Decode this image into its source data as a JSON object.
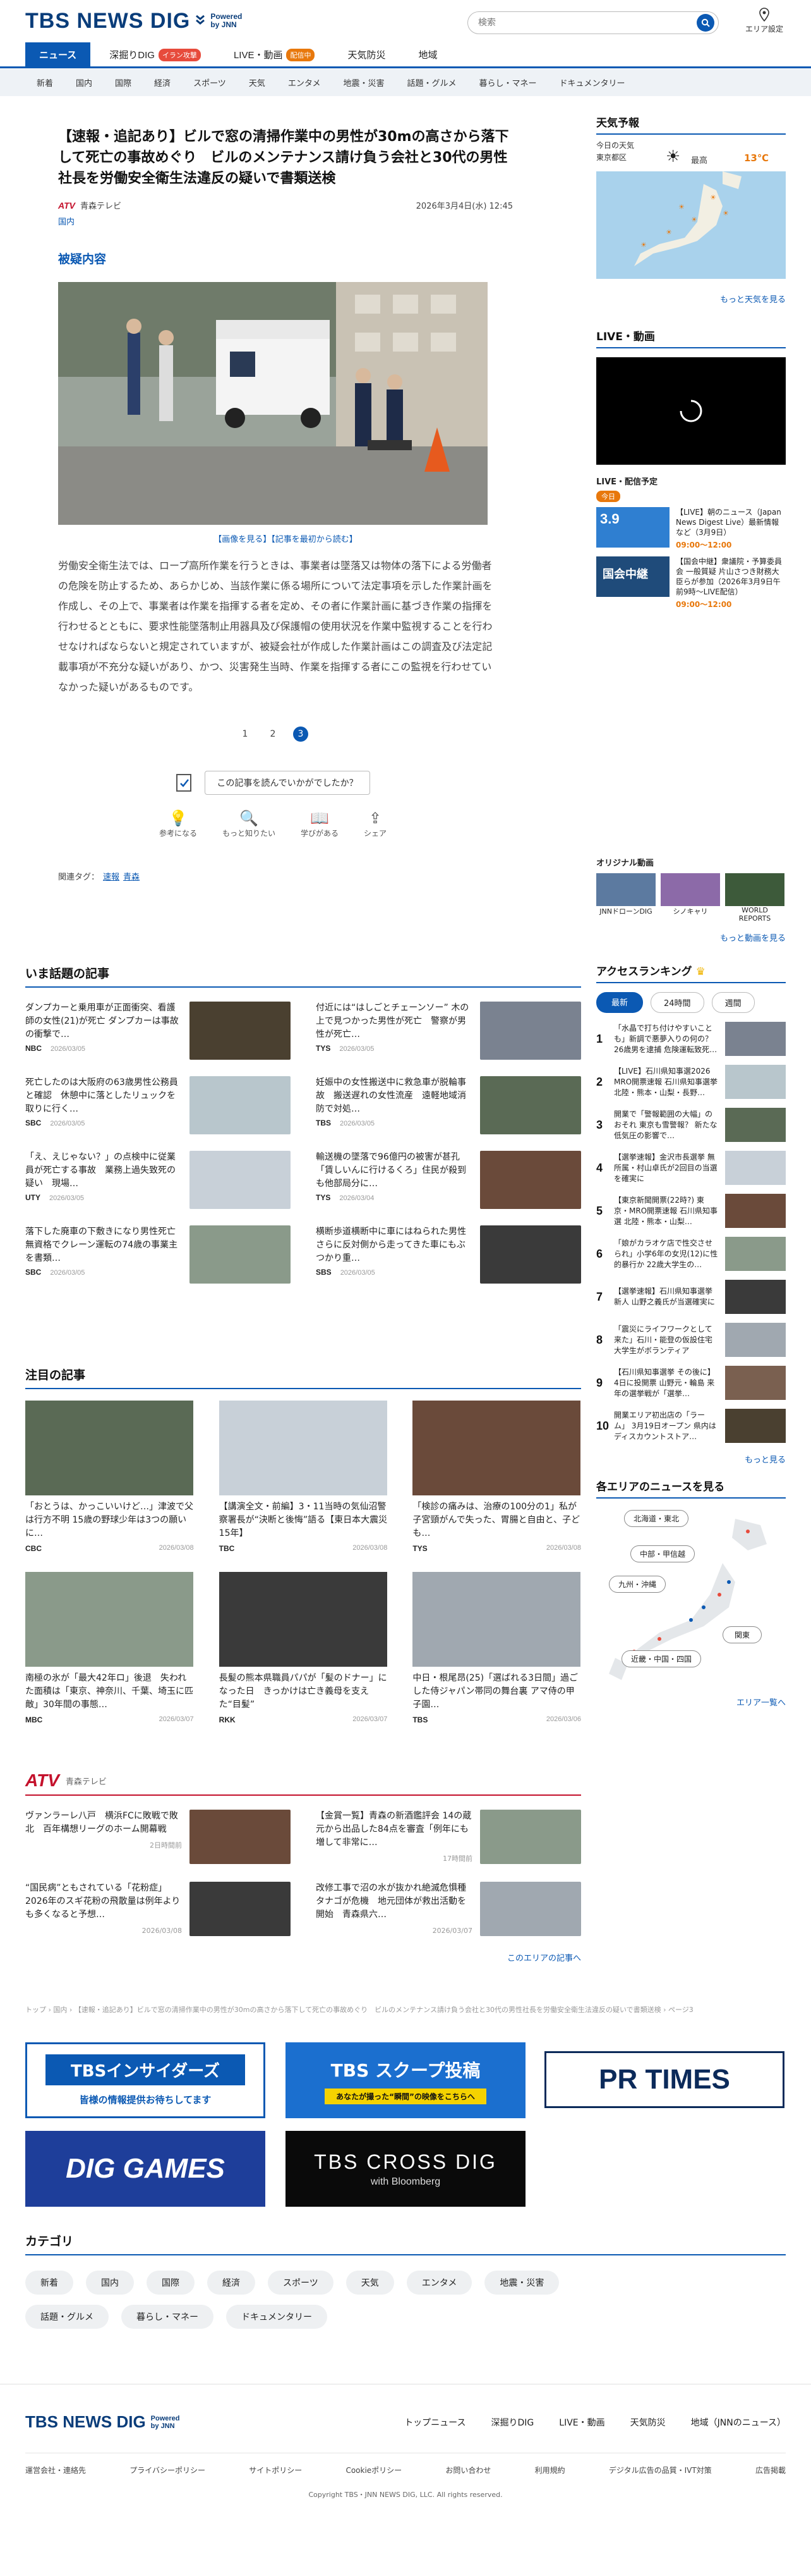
{
  "header": {
    "logo": "TBS NEWS DIG",
    "powered": "Powered by JNN",
    "search_placeholder": "検索",
    "area_label": "エリア設定"
  },
  "nav_main": [
    {
      "label": "ニュース"
    },
    {
      "label": "深掘りDIG",
      "badge": "イラン攻撃"
    },
    {
      "label": "LIVE・動画",
      "badge": "配信中"
    },
    {
      "label": "天気防災"
    },
    {
      "label": "地域"
    }
  ],
  "nav_sub": [
    "新着",
    "国内",
    "国際",
    "経済",
    "スポーツ",
    "天気",
    "エンタメ",
    "地震・災害",
    "話題・グルメ",
    "暮らし・マネー",
    "ドキュメンタリー"
  ],
  "article": {
    "title": "【速報・追記あり】ビルで窓の清掃作業中の男性が30mの高さから落下して死亡の事故めぐり　ビルのメンテナンス請け負う会社と30代の男性社長を労働安全衛生法違反の疑いで書類送検",
    "source_logo": "ATV",
    "source": "青森テレビ",
    "date": "2026年3月4日(水) 12:45",
    "category": "国内",
    "subheading": "被疑内容",
    "photo_captions": [
      "【画像を見る】",
      "【記事を最初から読む】"
    ],
    "body": "労働安全衛生法では、ロープ高所作業を行うときは、事業者は墜落又は物体の落下による労働者の危険を防止するため、あらかじめ、当該作業に係る場所について法定事項を示した作業計画を作成し、その上で、事業者は作業を指揮する者を定め、その者に作業計画に基づき作業の指揮を行わせるとともに、要求性能墜落制止用器具及び保護帽の使用状況を作業中監視することを行わせなければならないと規定されていますが、被疑会社が作成した作業計画はこの調査及び法定記載事項が不充分な疑いがあり、かつ、災害発生当時、作業を指揮する者にこの監視を行わせていなかった疑いがあるものです。",
    "pages": [
      "1",
      "2",
      "3"
    ],
    "survey": "この記事を読んでいかがでしたか？",
    "reactions": [
      {
        "icon": "lightbulb-icon",
        "label": "参考になる"
      },
      {
        "icon": "search-icon",
        "label": "もっと知りたい"
      },
      {
        "icon": "book-icon",
        "label": "学びがある"
      },
      {
        "icon": "share-icon",
        "label": "シェア"
      }
    ],
    "tags_label": "関連タグ：",
    "tags": [
      "速報",
      "青森"
    ]
  },
  "sidebar": {
    "weather": {
      "title": "天気予報",
      "today": "今日の天気",
      "region": "東京都区",
      "max_label": "最高",
      "max_temp": "13℃",
      "more": "もっと天気を見る"
    },
    "live": {
      "title": "LIVE・動画",
      "schedule_title": "LIVE・配信予定",
      "schedule_date": "3.9",
      "items": [
        {
          "title": "【LIVE】朝のニュース（Japan News Digest Live）最新情報など（3月9日）",
          "time": "09:00～12:00"
        },
        {
          "title": "【国会中継】衆議院・予算委員会 一般質疑 片山さつき財務大臣らが参加（2026年3月9日午前9時～LIVE配信）",
          "time": "09:00～12:00"
        }
      ]
    },
    "original": {
      "title": "オリジナル動画",
      "items": [
        "JNNドローンDIG",
        "シノキャリ",
        "WORLD REPORTS"
      ],
      "more": "もっと動画を見る"
    },
    "ranking": {
      "title": "アクセスランキング",
      "tabs": [
        "最新",
        "24時間",
        "週間"
      ],
      "items": [
        "「水晶で打ち付けやすいことも」新調で悪夢入りの何の？26歳男を逮捕 危険運転致死…",
        "【LIVE】石川県知事選2026 MRO開票速報 石川県知事選挙 北陸・熊本・山梨・長野…",
        "開業で「警報範囲の大幅」のおそれ 東京も雪警報？ 新たな低気圧の影響で…",
        "【選挙速報】金沢市長選挙 無所属・村山卓氏が2回目の当選を確実に",
        "【東京新聞開票(22時?) 東京・MRO開票速報 石川県知事選 北陸・熊本・山梨…",
        "「娘がカラオケ店で性交させられ」小学6年の女児(12)に性的暴行か 22歳大学生の…",
        "【選挙速報】石川県知事選挙 新人 山野之義氏が当選確実に",
        "「震災にライフワークとして来た」石川・能登の仮設住宅 大学生がボランティア",
        "【石川県知事選挙 その後に】4日に投開票 山野元・輪島 来年の選挙戦が「選挙…",
        "開業エリア初出店の「ラーム」 3月19日オープン 県内はディスカウントストア…"
      ],
      "more": "もっと見る"
    },
    "area": {
      "title": "各エリアのニュースを見る",
      "regions": [
        "北海道・東北",
        "中部・甲信越",
        "九州・沖縄",
        "関東",
        "近畿・中国・四国"
      ],
      "more": "エリア一覧へ"
    }
  },
  "topics": {
    "title": "いま話題の記事",
    "items": [
      {
        "text": "ダンプカーと乗用車が正面衝突、看護師の女性(21)が死亡 ダンプカーは事故の衝撃で…",
        "src": "NBC",
        "date": "2026/03/05"
      },
      {
        "text": "付近には“はしごとチェーンソー” 木の上で見つかった男性が死亡　警察が男性が死亡…",
        "src": "TYS",
        "date": "2026/03/05"
      },
      {
        "text": "死亡したのは大阪府の63歳男性公務員と確認　休憩中に落としたリュックを取りに行く…",
        "src": "SBC",
        "date": "2026/03/05"
      },
      {
        "text": "妊娠中の女性搬送中に救急車が脱輪事故　搬送遅れの女性流産　遠軽地域消防で対処…",
        "src": "TBS",
        "date": "2026/03/05"
      },
      {
        "text": "「え、えじゃない？」の点検中に従業員が死亡する事故　業務上過失致死の疑い　現場…",
        "src": "UTY",
        "date": "2026/03/05"
      },
      {
        "text": "輸送機の墜落で96億円の被害が甚孔「賃しいんに行けるくろ」住民が殺到も他部局分に…",
        "src": "TYS",
        "date": "2026/03/04"
      },
      {
        "text": "落下した廃車の下敷きになり男性死亡　無資格でクレーン運転の74歳の事業主を書類…",
        "src": "SBC",
        "date": "2026/03/05"
      },
      {
        "text": "横断歩道横断中に車にはねられた男性 さらに反対側から走ってきた車にもぶつかり重…",
        "src": "SBS",
        "date": "2026/03/05"
      }
    ]
  },
  "featured": {
    "title": "注目の記事",
    "items": [
      {
        "text": "「おとうは、かっこいいけど…」津波で父は行方不明 15歳の野球少年は3つの願いに…",
        "src": "CBC",
        "date": "2026/03/08"
      },
      {
        "text": "【講演全文・前編】3・11当時の気仙沼警察署長が“決断と後悔”語る【東日本大震災15年】",
        "src": "TBC",
        "date": "2026/03/08"
      },
      {
        "text": "「検診の痛みは、治療の100分の1」私が子宮頸がんで失った、胃腸と自由と、子ども…",
        "src": "TYS",
        "date": "2026/03/08"
      },
      {
        "text": "南極の氷が「最大42年ロ」後退　失われた面積は「東京、神奈川、千葉、埼玉に匹敵」30年間の事態…",
        "src": "MBC",
        "date": "2026/03/07"
      },
      {
        "text": "長髪の熊本県職員パパが「髪のドナー」になった日　きっかけは亡き義母を支えた“目髪”",
        "src": "RKK",
        "date": "2026/03/07"
      },
      {
        "text": "中日・根尾昂(25)「選ばれる3日間」過ごした侍ジャパン帯同の舞台裏 アマ侍の甲子園…",
        "src": "TBS",
        "date": "2026/03/06"
      }
    ]
  },
  "local": {
    "logo": "ATV",
    "label": "青森テレビ",
    "items": [
      {
        "text": "ヴァンラーレ八戸　横浜FCに敗戦で敗北　百年構想リーグのホーム開幕戦",
        "date": "2日時間前"
      },
      {
        "text": "【金賞一覧】青森の新酒鑑評会 14の蔵元から出品した84点を審査「例年にも増して非常に…",
        "date": "17時間前"
      },
      {
        "text": "“国民病”ともされている「花粉症」 2026年のスギ花粉の飛散量は例年よりも多くなると予想…",
        "date": "2026/03/08"
      },
      {
        "text": "改修工事で沼の水が抜かれ絶滅危惧種タナゴが危機　地元団体が救出活動を開始　青森県六…",
        "date": "2026/03/07"
      }
    ],
    "more": "このエリアの記事へ"
  },
  "breadcrumb": "トップ › 国内 › 【速報・追記あり】ビルで窓の清掃作業中の男性が30mの高さから落下して死亡の事故めぐり　ビルのメンテナンス請け負う会社と30代の男性社長を労働安全衛生法違反の疑いで書類送検 › ページ3",
  "banners": [
    {
      "title": "TBSインサイダーズ",
      "sub": "皆様の情報提供お待ちしてます"
    },
    {
      "title": "TBS スクープ投稿",
      "sub": "あなたが撮った“瞬間”の映像をこちらへ"
    },
    {
      "title": "PR TIMES"
    },
    {
      "title": "DIG GAMES"
    },
    {
      "title": "TBS CROSS DIG",
      "sub": "with Bloomberg"
    }
  ],
  "categories": {
    "title": "カテゴリ",
    "items": [
      "新着",
      "国内",
      "国際",
      "経済",
      "スポーツ",
      "天気",
      "エンタメ",
      "地震・災害",
      "話題・グルメ",
      "暮らし・マネー",
      "ドキュメンタリー"
    ]
  },
  "footer": {
    "links": [
      "トップニュース",
      "深掘りDIG",
      "LIVE・動画",
      "天気防災",
      "地域（JNNのニュース）"
    ],
    "sublinks": [
      "運営会社・連絡先",
      "プライバシーポリシー",
      "サイトポリシー",
      "Cookieポリシー",
      "お問い合わせ",
      "利用規約",
      "デジタル広告の品質・IVT対策",
      "広告掲載"
    ],
    "copyright": "Copyright TBS・JNN NEWS DIG, LLC. All rights reserved."
  }
}
